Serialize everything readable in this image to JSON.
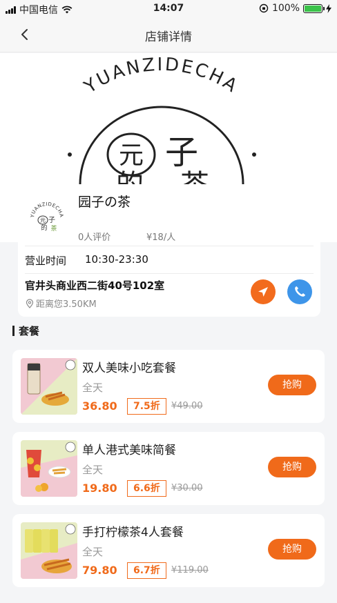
{
  "status_bar": {
    "carrier": "中国电信",
    "time": "14:07",
    "battery": "100%"
  },
  "nav": {
    "title": "店铺详情",
    "back_icon": "chevron-left-icon"
  },
  "banner": {
    "arc_text": "YUANZIDECHA",
    "logo_chars": [
      "元",
      "子",
      "的",
      "茶"
    ]
  },
  "shop": {
    "name": "园子の茶",
    "rating": "0人评价",
    "price_per_person": "¥18/人",
    "hours_label": "营业时间",
    "hours": "10:30-23:30",
    "address": "官井头商业西二街40号102室",
    "distance": "距离您3.50KM"
  },
  "section": {
    "title": "套餐"
  },
  "deals": [
    {
      "name": "双人美味小吃套餐",
      "availability": "全天",
      "price": "36.80",
      "discount": "7.5折",
      "original_price": "¥49.00",
      "buy_label": "抢购",
      "colors": [
        "#f2c9d2",
        "#e7ecc4"
      ]
    },
    {
      "name": "单人港式美味简餐",
      "availability": "全天",
      "price": "19.80",
      "discount": "6.6折",
      "original_price": "¥30.00",
      "buy_label": "抢购",
      "colors": [
        "#e7ecc4",
        "#f2c9d2"
      ]
    },
    {
      "name": "手打柠檬茶4人套餐",
      "availability": "全天",
      "price": "79.80",
      "discount": "6.7折",
      "original_price": "¥119.00",
      "buy_label": "抢购",
      "colors": [
        "#e7ecc4",
        "#f2c9d2"
      ]
    }
  ],
  "colors": {
    "accent": "#f06a1a",
    "call": "#3e95e9",
    "battery": "#3bc34a"
  }
}
